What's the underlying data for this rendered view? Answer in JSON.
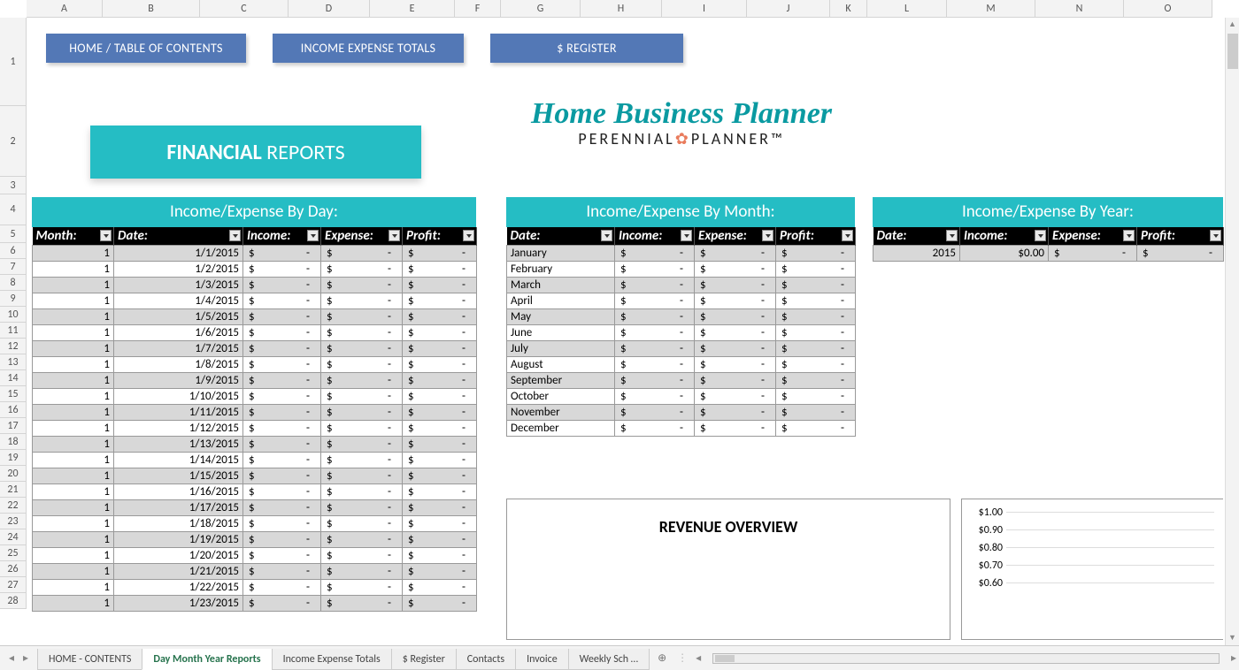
{
  "columns": [
    {
      "l": "A",
      "w": 86
    },
    {
      "l": "B",
      "w": 110
    },
    {
      "l": "C",
      "w": 100
    },
    {
      "l": "D",
      "w": 92
    },
    {
      "l": "E",
      "w": 96
    },
    {
      "l": "F",
      "w": 52
    },
    {
      "l": "G",
      "w": 90
    },
    {
      "l": "H",
      "w": 92
    },
    {
      "l": "I",
      "w": 96
    },
    {
      "l": "J",
      "w": 94
    },
    {
      "l": "K",
      "w": 42
    },
    {
      "l": "L",
      "w": 90
    },
    {
      "l": "M",
      "w": 100
    },
    {
      "l": "N",
      "w": 100
    },
    {
      "l": "O",
      "w": 100
    }
  ],
  "rows": [
    {
      "n": 1,
      "h": 100
    },
    {
      "n": 2,
      "h": 80
    },
    {
      "n": 3,
      "h": 20
    },
    {
      "n": 4,
      "h": 35
    },
    {
      "n": 5,
      "h": 20
    },
    {
      "n": 6,
      "h": 18
    },
    {
      "n": 7,
      "h": 18
    },
    {
      "n": 8,
      "h": 18
    },
    {
      "n": 9,
      "h": 18
    },
    {
      "n": 10,
      "h": 18
    },
    {
      "n": 11,
      "h": 18
    },
    {
      "n": 12,
      "h": 18
    },
    {
      "n": 13,
      "h": 18
    },
    {
      "n": 14,
      "h": 18
    },
    {
      "n": 15,
      "h": 18
    },
    {
      "n": 16,
      "h": 18
    },
    {
      "n": 17,
      "h": 18
    },
    {
      "n": 18,
      "h": 18
    },
    {
      "n": 19,
      "h": 18
    },
    {
      "n": 20,
      "h": 18
    },
    {
      "n": 21,
      "h": 18
    },
    {
      "n": 22,
      "h": 18
    },
    {
      "n": 23,
      "h": 18
    },
    {
      "n": 24,
      "h": 18
    },
    {
      "n": 25,
      "h": 18
    },
    {
      "n": 26,
      "h": 18
    },
    {
      "n": 27,
      "h": 18
    },
    {
      "n": 28,
      "h": 18
    }
  ],
  "nav": {
    "home": "HOME / TABLE OF CONTENTS",
    "totals": "INCOME EXPENSE TOTALS",
    "register": "$ REGISTER"
  },
  "fin_btn": {
    "bold": "FINANCIAL",
    "rest": " REPORTS"
  },
  "logo": {
    "top": "Home Business Planner",
    "bot_a": "PERENNIAL",
    "bot_b": "PLANNER",
    "tm": "™"
  },
  "sections": {
    "day": "Income/Expense By Day:",
    "month": "Income/Expense By Month:",
    "year": "Income/Expense By Year:"
  },
  "day": {
    "headers": [
      "Month:",
      "Date:",
      "Income:",
      "Expense:",
      "Profit:"
    ],
    "rows": [
      {
        "m": 1,
        "d": "1/1/2015"
      },
      {
        "m": 1,
        "d": "1/2/2015"
      },
      {
        "m": 1,
        "d": "1/3/2015"
      },
      {
        "m": 1,
        "d": "1/4/2015"
      },
      {
        "m": 1,
        "d": "1/5/2015"
      },
      {
        "m": 1,
        "d": "1/6/2015"
      },
      {
        "m": 1,
        "d": "1/7/2015"
      },
      {
        "m": 1,
        "d": "1/8/2015"
      },
      {
        "m": 1,
        "d": "1/9/2015"
      },
      {
        "m": 1,
        "d": "1/10/2015"
      },
      {
        "m": 1,
        "d": "1/11/2015"
      },
      {
        "m": 1,
        "d": "1/12/2015"
      },
      {
        "m": 1,
        "d": "1/13/2015"
      },
      {
        "m": 1,
        "d": "1/14/2015"
      },
      {
        "m": 1,
        "d": "1/15/2015"
      },
      {
        "m": 1,
        "d": "1/16/2015"
      },
      {
        "m": 1,
        "d": "1/17/2015"
      },
      {
        "m": 1,
        "d": "1/18/2015"
      },
      {
        "m": 1,
        "d": "1/19/2015"
      },
      {
        "m": 1,
        "d": "1/20/2015"
      },
      {
        "m": 1,
        "d": "1/21/2015"
      },
      {
        "m": 1,
        "d": "1/22/2015"
      },
      {
        "m": 1,
        "d": "1/23/2015"
      }
    ],
    "dash": "-",
    "cur": "$"
  },
  "month": {
    "headers": [
      "Date:",
      "Income:",
      "Expense:",
      "Profit:"
    ],
    "rows": [
      "January",
      "February",
      "March",
      "April",
      "May",
      "June",
      "July",
      "August",
      "September",
      "October",
      "November",
      "December"
    ],
    "dash": "-",
    "cur": "$"
  },
  "year": {
    "headers": [
      "Date:",
      "Income:",
      "Expense:",
      "Profit:"
    ],
    "row": {
      "year": "2015",
      "income": "$0.00"
    },
    "dash": "-",
    "cur": "$"
  },
  "chart": {
    "title": "REVENUE OVERVIEW",
    "yticks": [
      "$1.00",
      "$0.90",
      "$0.80",
      "$0.70",
      "$0.60"
    ]
  },
  "tabs": {
    "list": [
      "HOME - CONTENTS",
      "Day Month Year Reports",
      "Income Expense Totals",
      "$ Register",
      "Contacts",
      "Invoice",
      "Weekly Sch …"
    ],
    "active": 1
  }
}
